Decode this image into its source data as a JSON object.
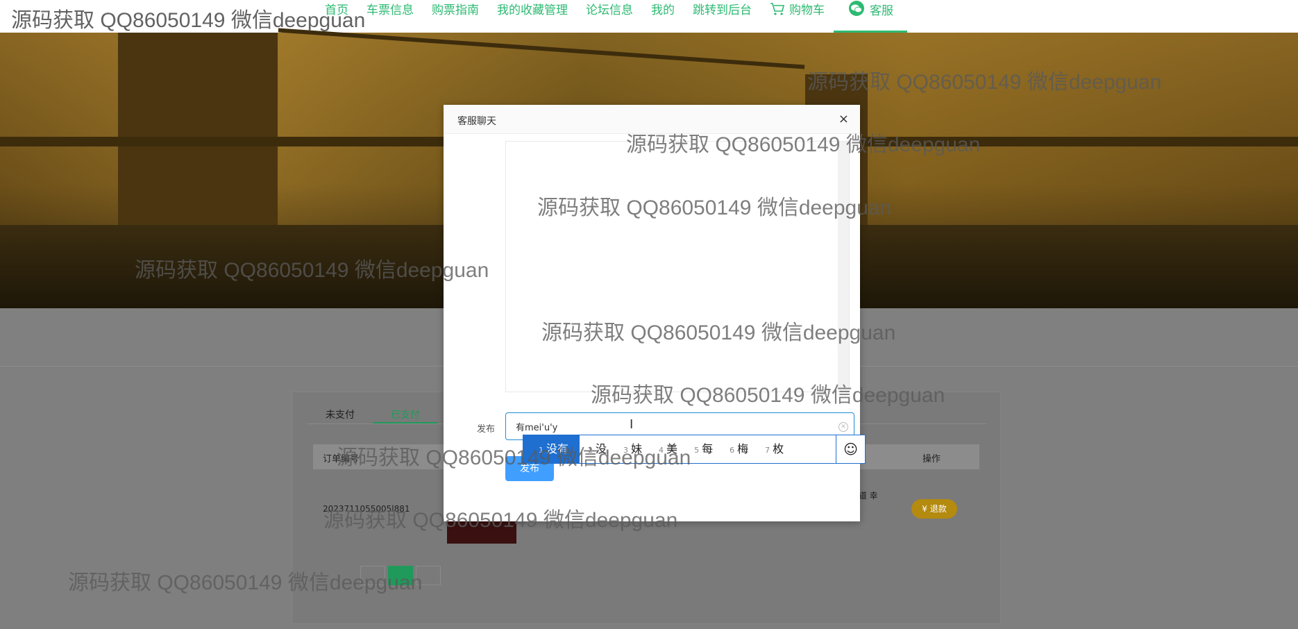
{
  "nav": {
    "items": [
      "首页",
      "车票信息",
      "购票指南",
      "我的收藏管理",
      "论坛信息",
      "我的",
      "跳转到后台",
      "购物车",
      "客服"
    ],
    "active": "客服"
  },
  "orders": {
    "tabs": [
      "未支付",
      "已支付"
    ],
    "active_tab": "已支付",
    "headers": [
      "订单编号",
      "操作"
    ],
    "row": {
      "order_id": "2023711055005l881",
      "address": "海市环 楼街道 幸福广场",
      "refund_label": "退款"
    }
  },
  "modal": {
    "title": "客服聊天",
    "close_label": "×",
    "post_label": "发布",
    "input_value": "有mei'u'y",
    "post_button": "发布"
  },
  "ime": {
    "candidates": [
      {
        "num": "1",
        "text": "没有"
      },
      {
        "num": "2",
        "text": "没"
      },
      {
        "num": "3",
        "text": "妹"
      },
      {
        "num": "4",
        "text": "美"
      },
      {
        "num": "5",
        "text": "每"
      },
      {
        "num": "6",
        "text": "梅"
      },
      {
        "num": "7",
        "text": "枚"
      }
    ],
    "selected_index": 0,
    "emoji": "☺"
  },
  "watermark": {
    "text": "源码获取 QQ86050149 微信deepguan"
  }
}
